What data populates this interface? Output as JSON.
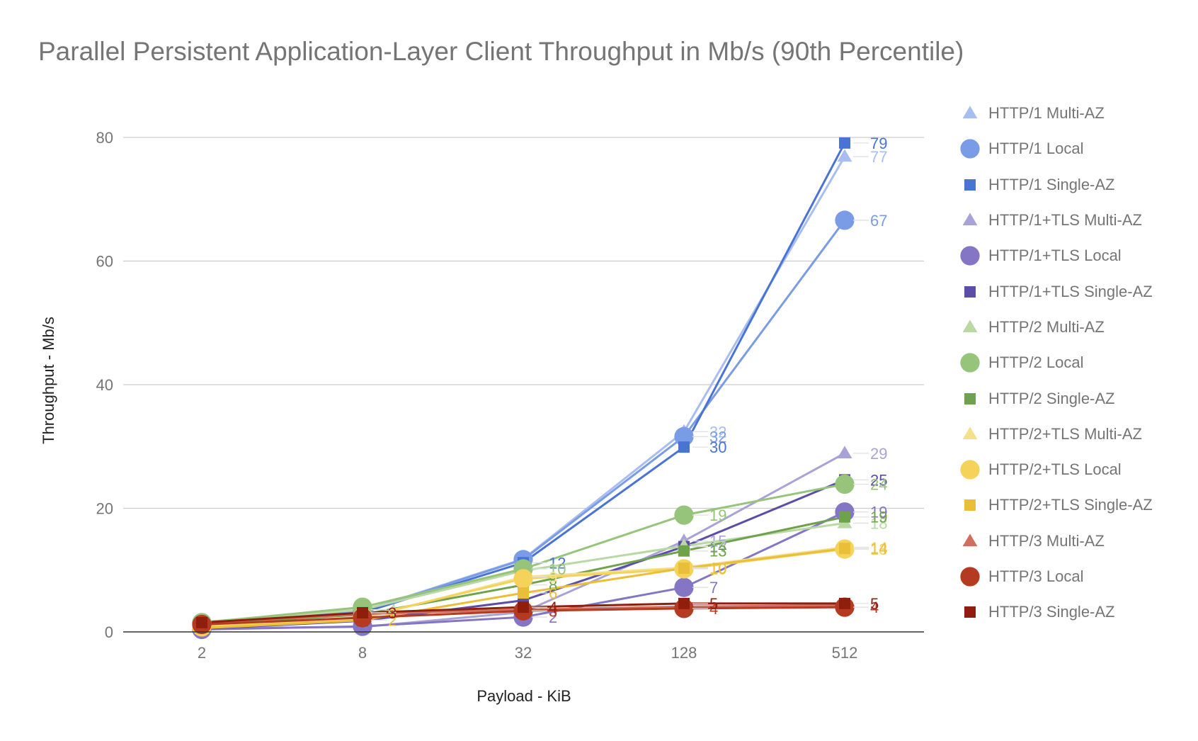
{
  "chart_data": {
    "type": "line",
    "title": "Parallel Persistent Application-Layer Client Throughput in Mb/s (90th Percentile)",
    "xlabel": "Payload - KiB",
    "ylabel": "Throughput - Mb/s",
    "categories": [
      "2",
      "8",
      "32",
      "128",
      "512"
    ],
    "ylim": [
      0,
      80
    ],
    "yticks": [
      0,
      20,
      40,
      60,
      80
    ],
    "grid": true,
    "legend_position": "right",
    "series": [
      {
        "name": "HTTP/1 Multi-AZ",
        "values": [
          1.5,
          3.4,
          11.8,
          32.4,
          76.9
        ],
        "labels": [
          "",
          "",
          "",
          "32",
          "77"
        ],
        "color": "#a8bdf0",
        "marker": "triangle"
      },
      {
        "name": "HTTP/1 Local",
        "values": [
          1.4,
          3.3,
          11.7,
          31.6,
          66.6
        ],
        "labels": [
          "",
          "",
          "",
          "32",
          "67"
        ],
        "color": "#7a9be6",
        "marker": "circle"
      },
      {
        "name": "HTTP/1 Single-AZ",
        "values": [
          1.3,
          3.1,
          11.2,
          29.9,
          79.1
        ],
        "labels": [
          "",
          "",
          "12",
          "30",
          "79"
        ],
        "color": "#4a74d4",
        "marker": "square"
      },
      {
        "name": "HTTP/1+TLS Multi-AZ",
        "values": [
          0.6,
          0.8,
          3.2,
          14.7,
          28.9
        ],
        "labels": [
          "",
          "",
          "",
          "15",
          "29"
        ],
        "color": "#a9a2d6",
        "marker": "triangle"
      },
      {
        "name": "HTTP/1+TLS Local",
        "values": [
          0.4,
          0.9,
          2.4,
          7.2,
          19.4
        ],
        "labels": [
          "",
          "",
          "2",
          "7",
          "19"
        ],
        "color": "#8476c4",
        "marker": "circle"
      },
      {
        "name": "HTTP/1+TLS Single-AZ",
        "values": [
          0.5,
          1.8,
          5.1,
          13.8,
          24.6
        ],
        "labels": [
          "",
          "",
          "",
          "14",
          "25"
        ],
        "color": "#5c4ea6",
        "marker": "square"
      },
      {
        "name": "HTTP/2 Multi-AZ",
        "values": [
          1.6,
          3.6,
          9.9,
          13.9,
          17.6
        ],
        "labels": [
          "",
          "4",
          "",
          "14",
          "18"
        ],
        "color": "#b9d8a4",
        "marker": "triangle"
      },
      {
        "name": "HTTP/2 Local",
        "values": [
          1.5,
          4.0,
          10.2,
          18.9,
          23.9
        ],
        "labels": [
          "",
          "",
          "10",
          "19",
          "24"
        ],
        "color": "#96c47b",
        "marker": "circle"
      },
      {
        "name": "HTTP/2 Single-AZ",
        "values": [
          1.3,
          2.8,
          7.6,
          13.1,
          18.6
        ],
        "labels": [
          "",
          "",
          "8",
          "13",
          "19"
        ],
        "color": "#6fa24c",
        "marker": "square"
      },
      {
        "name": "HTTP/2+TLS Multi-AZ",
        "values": [
          0.9,
          2.2,
          8.9,
          10.4,
          13.7
        ],
        "labels": [
          "",
          "",
          "9",
          "10",
          "14"
        ],
        "color": "#f5e18c",
        "marker": "triangle"
      },
      {
        "name": "HTTP/2+TLS Local",
        "values": [
          0.8,
          2.4,
          8.6,
          10.2,
          13.4
        ],
        "labels": [
          "",
          "",
          "",
          "10",
          "13"
        ],
        "color": "#f5d35a",
        "marker": "circle"
      },
      {
        "name": "HTTP/2+TLS Single-AZ",
        "values": [
          0.6,
          1.9,
          6.3,
          10.3,
          13.5
        ],
        "labels": [
          "",
          "2",
          "6",
          "10",
          "14"
        ],
        "color": "#e9bf39",
        "marker": "square"
      },
      {
        "name": "HTTP/3 Multi-AZ",
        "values": [
          1.5,
          2.9,
          3.6,
          4.1,
          4.3
        ],
        "labels": [
          "",
          "",
          "",
          "",
          ""
        ],
        "color": "#cd7060",
        "marker": "triangle"
      },
      {
        "name": "HTTP/3 Local",
        "values": [
          1.2,
          2.3,
          3.4,
          3.8,
          4.0
        ],
        "labels": [
          "",
          "",
          "3",
          "4",
          "4"
        ],
        "color": "#b53a22",
        "marker": "circle"
      },
      {
        "name": "HTTP/3 Single-AZ",
        "values": [
          1.5,
          3.1,
          4.0,
          4.6,
          4.6
        ],
        "labels": [
          "",
          "3",
          "4",
          "5",
          "5"
        ],
        "color": "#8f1f0c",
        "marker": "square"
      }
    ]
  }
}
